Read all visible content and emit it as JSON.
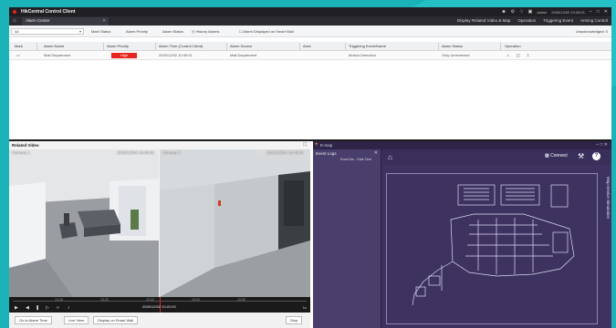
{
  "app": {
    "title": "HikCentral Control Client",
    "tab_label": "Alarm Center",
    "title_icons": [
      "user-icon",
      "settings-icon",
      "bell-icon",
      "lock-icon"
    ],
    "user_text": "admin",
    "time_text": "2020/12/02 10:45:01"
  },
  "menu": {
    "display": "Display Related Video & Map",
    "operation": "Operation",
    "triggering": "Triggering Event",
    "arming": "Arming Control"
  },
  "toolbar": {
    "filter_value": "All",
    "mark_status": "Mark Status",
    "alarm_priority": "Alarm Priority",
    "alarm_status": "Alarm Status",
    "history": "History Alarms",
    "displayed_smart_wall": "Alarm Displayed on Smart Wall",
    "unacknowledged": "Unacknowledged: 0"
  },
  "table": {
    "headers": [
      "Mark",
      "Alarm Name",
      "Alarm Priority",
      "Alarm Time (Control Client)",
      "Alarm Source",
      "Area",
      "Triggering Event/Name",
      "Alarm Status",
      "Operation"
    ],
    "rows": [
      {
        "name": "Mall Department",
        "priority": "High",
        "time": "2020/12/02 10:45:01",
        "source": "Mall Department",
        "area": "",
        "triggering": "Motion Detection",
        "status": "Only Unreviewed"
      }
    ]
  },
  "related_video": {
    "title": "Related Video",
    "cameras": [
      {
        "label": "Camera 1",
        "time": "2020/12/02 10:45:01"
      },
      {
        "label": "Camera 2",
        "time": "2020/12/02 10:45:01"
      }
    ],
    "timestamp": "2020/12/02 10:21:02",
    "ticks": [
      "10:18",
      "10:20",
      "10:22",
      "10:24",
      "10:26"
    ],
    "right_controls": "1x",
    "buttons": {
      "go_to_alarm": "Go to Alarm Time",
      "live_view": "Live View",
      "display_smart_wall": "Display on Smart Wall",
      "stop": "Stop"
    }
  },
  "emap": {
    "title": "E-map",
    "event_logs": "Event Logs",
    "event_cols": "Event Na...   Date Time",
    "connect": "Connect",
    "side_label": "Map  Device  Simulation",
    "help": "?"
  },
  "colors": {
    "priority_high": "#e8261f",
    "emap_bg": "#3a2f5a"
  }
}
